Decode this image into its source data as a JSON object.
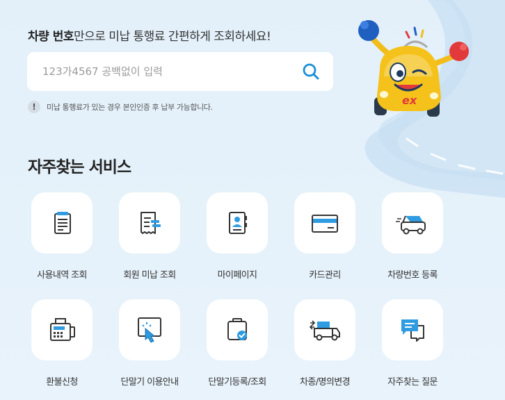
{
  "search": {
    "headline_bold": "차량 번호",
    "headline_rest": "만으로 미납 통행료 간편하게 조회하세요!",
    "placeholder": "123가4567 공백없이 입력",
    "notice": "미납 통행료가 있는 경우 본인인증 후 납부 가능합니다."
  },
  "services": {
    "title": "자주찾는 서비스",
    "items": [
      {
        "label": "사용내역 조회",
        "icon": "receipt-list-icon"
      },
      {
        "label": "회원 미납 조회",
        "icon": "unpaid-bill-icon"
      },
      {
        "label": "마이페이지",
        "icon": "profile-card-icon"
      },
      {
        "label": "카드관리",
        "icon": "credit-card-icon"
      },
      {
        "label": "차량번호 등록",
        "icon": "car-register-icon"
      },
      {
        "label": "환불신청",
        "icon": "refund-machine-icon"
      },
      {
        "label": "단말기 이용안내",
        "icon": "tap-terminal-icon"
      },
      {
        "label": "단말기등록/조회",
        "icon": "terminal-check-icon"
      },
      {
        "label": "차종/명의변경",
        "icon": "truck-change-icon"
      },
      {
        "label": "자주찾는 질문",
        "icon": "faq-chat-icon"
      }
    ]
  },
  "mascot": {
    "badge": "ex"
  },
  "colors": {
    "accent": "#1a8fd8",
    "dark": "#333333",
    "blue_light": "#2f9be0"
  }
}
